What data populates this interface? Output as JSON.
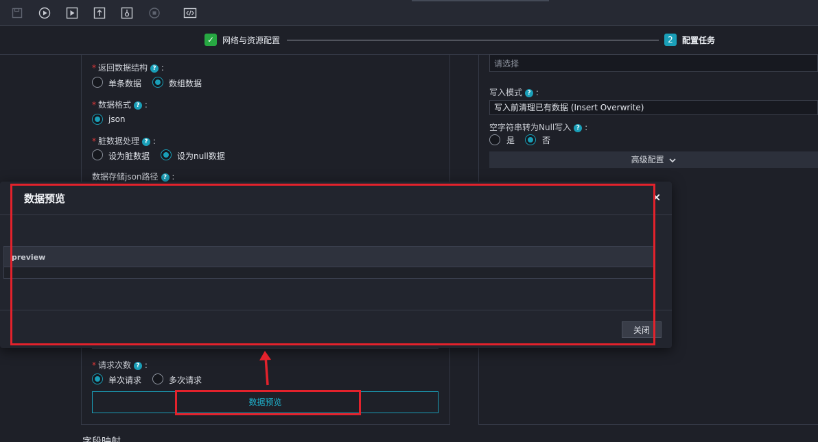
{
  "toolbar": {
    "icons": [
      "save-icon",
      "run-icon",
      "run-debug-icon",
      "submit-icon",
      "deploy-icon",
      "stop-icon",
      "code-view-icon"
    ]
  },
  "steps": [
    {
      "label": "网络与资源配置",
      "status": "done",
      "marker": "✓"
    },
    {
      "label": "配置任务",
      "status": "active",
      "marker": "2"
    }
  ],
  "left_form": {
    "return_structure": {
      "label": "返回数据结构",
      "help": "?",
      "options": [
        "单条数据",
        "数组数据"
      ],
      "selected": "数组数据"
    },
    "data_format": {
      "label": "数据格式",
      "help": "?",
      "options": [
        "json"
      ],
      "selected": "json"
    },
    "dirty_data": {
      "label": "脏数据处理",
      "help": "?",
      "options": [
        "设为脏数据",
        "设为null数据"
      ],
      "selected": "设为null数据"
    },
    "json_path": {
      "label": "数据存储json路径",
      "help": "?"
    },
    "request_count": {
      "label": "请求次数",
      "help": "?",
      "options": [
        "单次请求",
        "多次请求"
      ],
      "selected": "单次请求"
    },
    "preview_button": "数据预览",
    "section_title": "字段映射"
  },
  "right_form": {
    "select_placeholder": "请选择",
    "write_mode": {
      "label": "写入模式",
      "help": "?",
      "value": "写入前清理已有数据 (Insert Overwrite)"
    },
    "empty_to_null": {
      "label": "空字符串转为Null写入",
      "help": "?",
      "options": [
        "是",
        "否"
      ],
      "selected": "否"
    },
    "advanced_button": "高级配置",
    "advanced_icon": "chevron-down-icon"
  },
  "modal": {
    "title": "数据预览",
    "close_icon": "×",
    "table_columns": [
      "preview"
    ],
    "close_button": "关闭"
  },
  "colors": {
    "accent": "#1a9fb8",
    "success": "#27a842",
    "highlight": "#e3222c",
    "background": "#1e2028"
  }
}
